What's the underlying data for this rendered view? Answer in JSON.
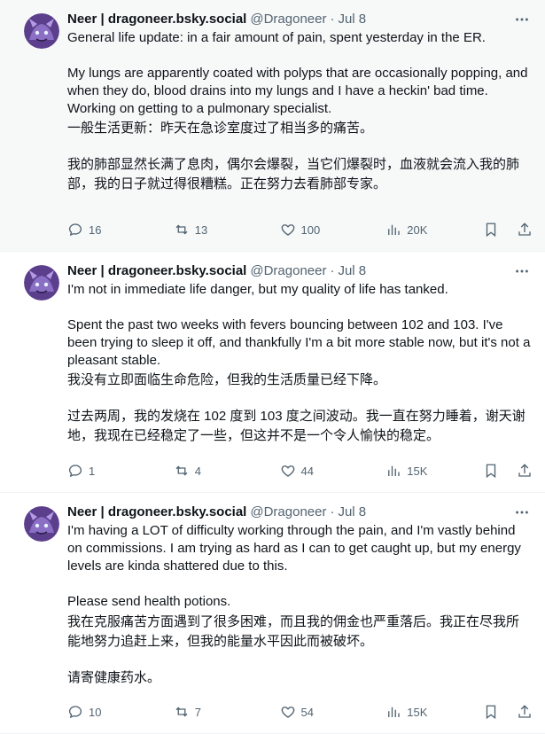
{
  "tweets": [
    {
      "author": "Neer | dragoneer.bsky.social",
      "handle": "@Dragoneer",
      "separator": "·",
      "date": "Jul 8",
      "paragraphs": [
        "General life update: in a fair amount of pain, spent yesterday in the ER.",
        "",
        "My lungs are apparently coated with polyps that are occasionally popping, and when they do, blood drains into my lungs and I have a heckin' bad time. Working on getting to a pulmonary specialist.",
        "一般生活更新：昨天在急诊室度过了相当多的痛苦。",
        "",
        "我的肺部显然长满了息肉，偶尔会爆裂，当它们爆裂时，血液就会流入我的肺部，我的日子就过得很糟糕。正在努力去看肺部专家。"
      ],
      "replies": "16",
      "reposts": "13",
      "likes": "100",
      "views": "20K"
    },
    {
      "author": "Neer | dragoneer.bsky.social",
      "handle": "@Dragoneer",
      "separator": "·",
      "date": "Jul 8",
      "paragraphs": [
        "I'm not in immediate life danger, but my quality of life has tanked.",
        "",
        "Spent the past two weeks with fevers bouncing between 102 and 103. I've been trying to sleep it off, and thankfully I'm a bit more stable now, but it's not a pleasant stable.",
        "我没有立即面临生命危险，但我的生活质量已经下降。",
        "",
        "过去两周，我的发烧在 102 度到 103 度之间波动。我一直在努力睡着，谢天谢地，我现在已经稳定了一些，但这并不是一个令人愉快的稳定。"
      ],
      "replies": "1",
      "reposts": "4",
      "likes": "44",
      "views": "15K"
    },
    {
      "author": "Neer | dragoneer.bsky.social",
      "handle": "@Dragoneer",
      "separator": "·",
      "date": "Jul 8",
      "paragraphs": [
        "I'm having a LOT of difficulty working through the pain, and I'm vastly behind on commissions. I am trying as hard as I can to get caught up, but my energy levels are kinda shattered due to this.",
        "",
        "Please send health potions.",
        "我在克服痛苦方面遇到了很多困难，而且我的佣金也严重落后。我正在尽我所能地努力追赶上来，但我的能量水平因此而被破坏。",
        "",
        "请寄健康药水。"
      ],
      "replies": "10",
      "reposts": "7",
      "likes": "54",
      "views": "15K"
    }
  ]
}
